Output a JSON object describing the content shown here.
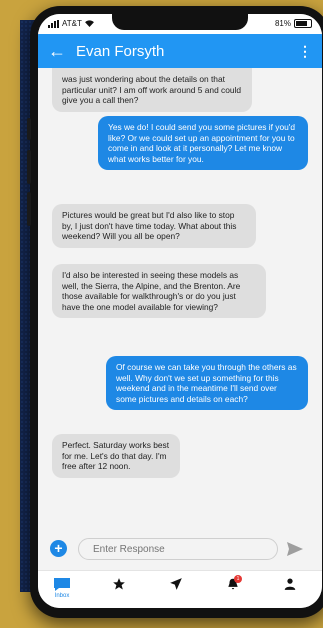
{
  "status": {
    "carrier": "AT&T",
    "battery": "81%"
  },
  "header": {
    "title": "Evan Forsyth"
  },
  "messages": [
    {
      "from": "contact",
      "text": "was just wondering about the details on that particular unit? I am off work around 5 and could give you a call then?"
    },
    {
      "from": "me",
      "text": "Yes we do! I could send you some pictures if you'd like? Or we could set up an appointment for you to come in and look at it personally? Let me know what works better for you."
    },
    {
      "from": "contact",
      "text": "Pictures would be great but I'd also like to stop by, I just don't have time today. What about this weekend? Will you all be open?"
    },
    {
      "from": "contact",
      "text": "I'd also be interested in seeing these models as well, the Sierra, the Alpine, and the Brenton. Are those available for walkthrough's or do you just have the one model available for viewing?"
    },
    {
      "from": "me",
      "text": "Of course we can take you through the others as well. Why don't we set up something for this weekend and in the meantime I'll send over some pictures and details on each?"
    },
    {
      "from": "contact",
      "text": "Perfect. Saturday works best for me. Let's do that day. I'm free after 12 noon."
    }
  ],
  "composer": {
    "placeholder": "Enter Response"
  },
  "tabs": [
    {
      "label": "Inbox",
      "icon": "chat-icon"
    },
    {
      "label": "",
      "icon": "star-icon"
    },
    {
      "label": "",
      "icon": "send-icon"
    },
    {
      "label": "",
      "icon": "bell-icon",
      "badge": "1"
    },
    {
      "label": "",
      "icon": "person-icon"
    }
  ],
  "colors": {
    "accent": "#2196f3",
    "outgoing": "#1e88e5",
    "incoming": "#dedede",
    "badge": "#e53935"
  }
}
